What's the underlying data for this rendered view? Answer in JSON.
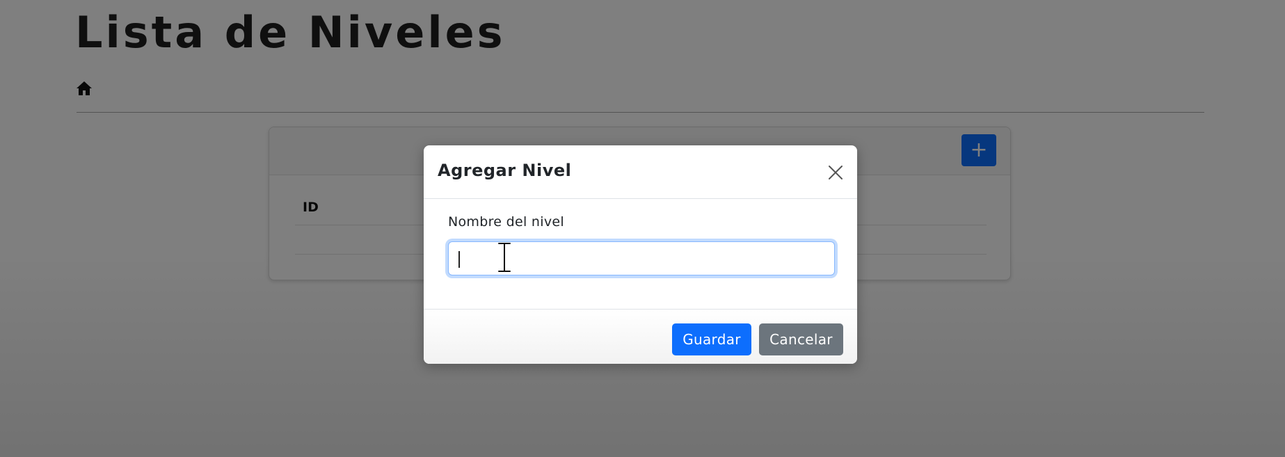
{
  "page": {
    "title": "Lista de Niveles",
    "home_icon": "home-icon"
  },
  "card": {
    "add_button_label": "+",
    "table": {
      "columns": [
        "ID"
      ]
    }
  },
  "modal": {
    "title": "Agregar Nivel",
    "close_icon": "close-icon",
    "field_label": "Nombre del nivel",
    "field_value": "",
    "save_label": "Guardar",
    "cancel_label": "Cancelar"
  },
  "colors": {
    "primary": "#0d6efd",
    "secondary": "#6c757d",
    "backdrop": "rgba(0,0,0,0.5)"
  }
}
